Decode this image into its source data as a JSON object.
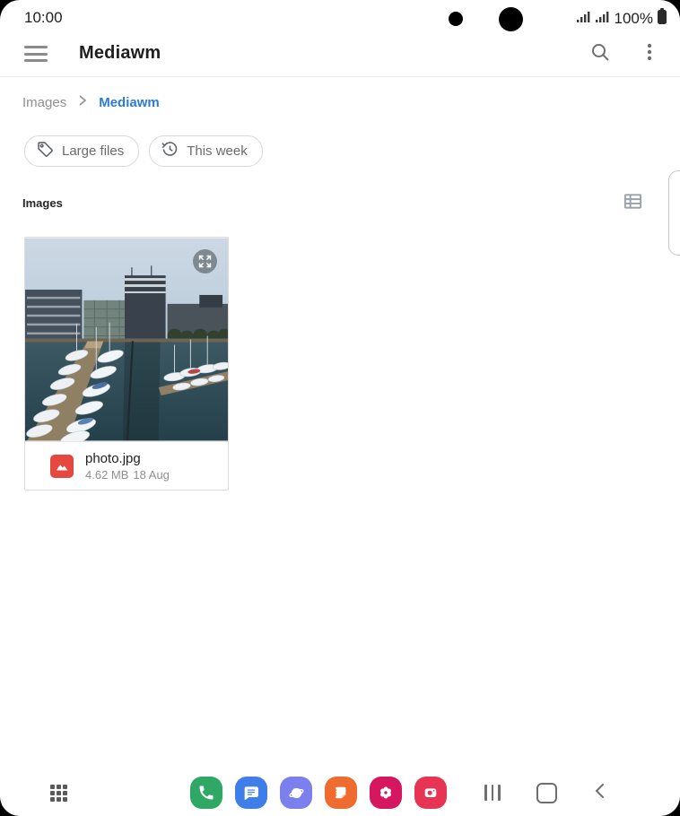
{
  "status_bar": {
    "time": "10:00",
    "battery_percent": "100%"
  },
  "app_bar": {
    "title": "Mediawm"
  },
  "breadcrumb": {
    "parent": "Images",
    "current": "Mediawm"
  },
  "filter_chips": [
    {
      "label": "Large files",
      "icon": "tag-icon"
    },
    {
      "label": "This week",
      "icon": "history-icon"
    }
  ],
  "section": {
    "title": "Images"
  },
  "files": [
    {
      "name": "photo.jpg",
      "size": "4.62 MB",
      "date": "18 Aug"
    }
  ],
  "colors": {
    "accent_blue": "#2c7cd5",
    "file_icon_red": "#e5483f",
    "phone_green": "#2fa866",
    "messages_blue": "#3f7de8",
    "internet_indigo": "#7b80ee",
    "notes_orange": "#ef6c30",
    "gallery_pink": "#d6175f",
    "camera_red": "#e73455"
  },
  "bottom_nav": {
    "app_icons": [
      {
        "name": "phone",
        "color": "#2fa866"
      },
      {
        "name": "messages",
        "color": "#3f7de8"
      },
      {
        "name": "internet",
        "color": "#7b80ee"
      },
      {
        "name": "notes",
        "color": "#ef6c30"
      },
      {
        "name": "gallery",
        "color": "#d6175f"
      },
      {
        "name": "camera",
        "color": "#e73455"
      }
    ]
  }
}
